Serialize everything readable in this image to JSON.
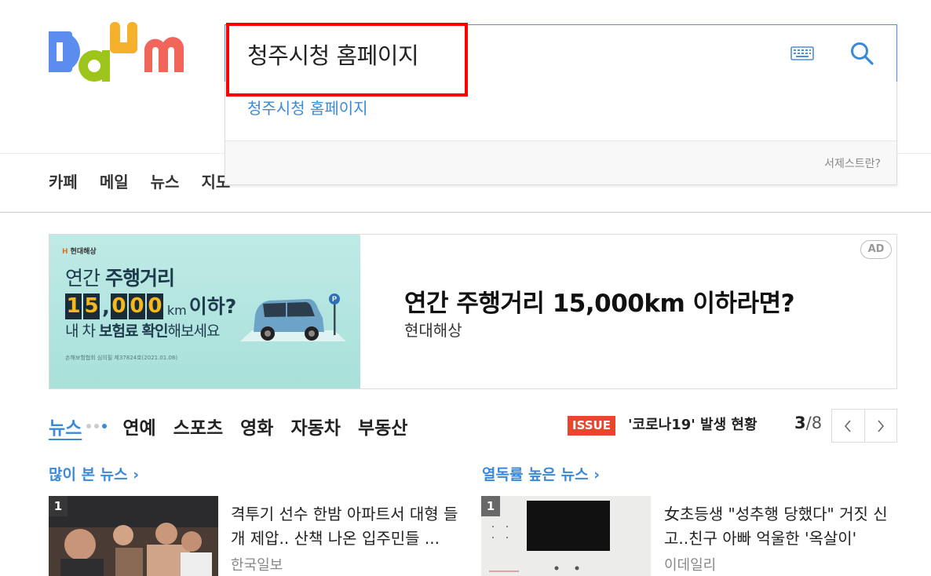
{
  "search": {
    "query": "청주시청 홈페이지",
    "suggestion": "청주시청 홈페이지",
    "help_link": "서제스트란?"
  },
  "gnb": [
    "카페",
    "메일",
    "뉴스",
    "지도"
  ],
  "ad": {
    "brand": "현대해상",
    "banner_line1_prefix": "연간 ",
    "banner_line1_bold": "주행거리",
    "banner_digits": [
      "1",
      "5",
      "0",
      "0",
      "0"
    ],
    "banner_km": "km",
    "banner_under": "이하?",
    "banner_line2_prefix": "내 차 ",
    "banner_line2_bold1": "보험료",
    "banner_line2_mid": " ",
    "banner_line2_bold2": "확인",
    "banner_line2_suffix": "해보세요",
    "banner_fine": "손해보험협회 심의필 제37824호(2021.01.08)",
    "title": "연간 주행거리 15,000km 이하라면?",
    "advertiser": "현대해상",
    "badge": "AD"
  },
  "tabs": [
    "뉴스",
    "연예",
    "스포츠",
    "영화",
    "자동차",
    "부동산"
  ],
  "issue": {
    "badge": "ISSUE",
    "text": "'코로나19' 발생 현황",
    "page_current": "3",
    "page_total": "/8"
  },
  "sections": [
    {
      "title": "많이 본 뉴스",
      "rank": "1",
      "headline": "격투기 선수 한밤 아파트서 대형 들개 제압.. 산책 나온 입주민들 ...",
      "source": "한국일보"
    },
    {
      "title": "열독률 높은 뉴스",
      "rank": "1",
      "headline": "女초등생 \"성추행 당했다\" 거짓 신고..친구 아빠 억울한 '옥살이'",
      "source": "이데일리"
    }
  ],
  "colors": {
    "accent": "#3b8ad9",
    "issue": "#e7462a",
    "highlight": "#ff0000"
  }
}
